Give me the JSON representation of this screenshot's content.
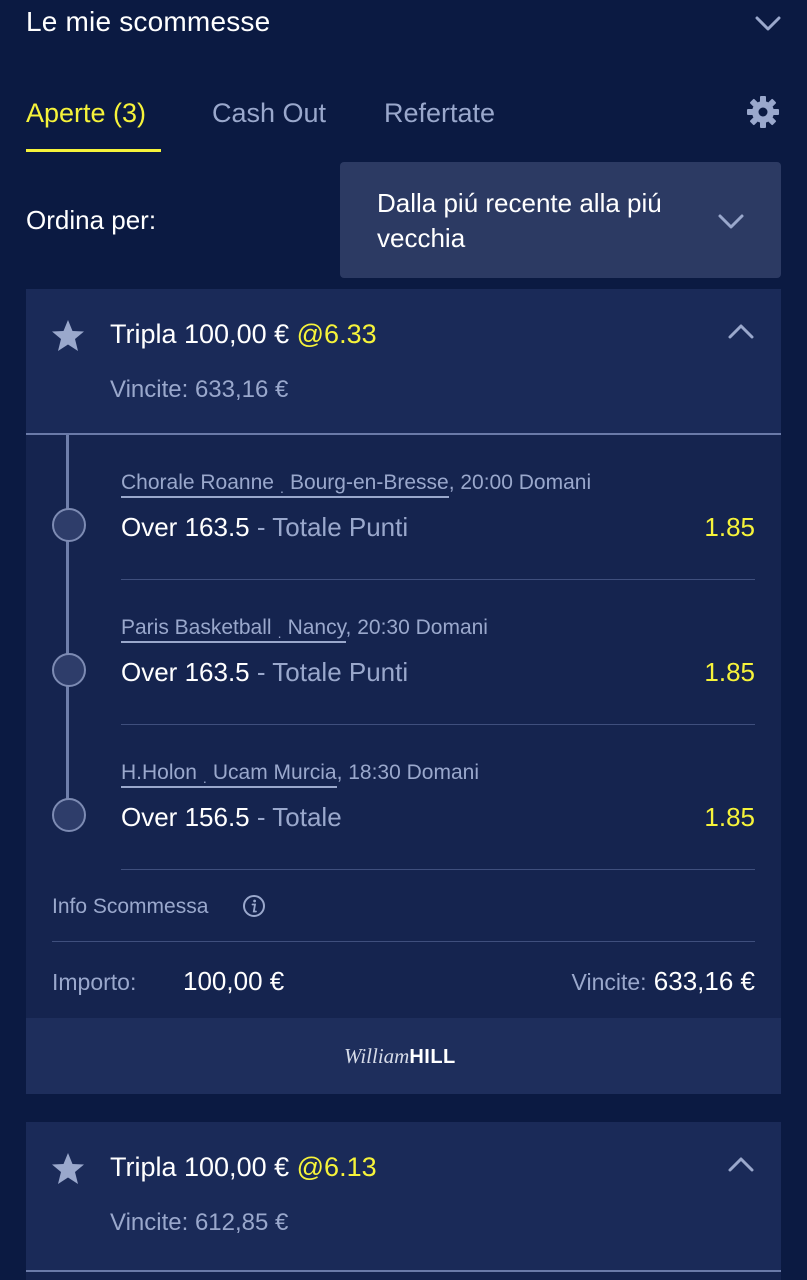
{
  "header": {
    "title": "Le mie scommesse"
  },
  "tabs": [
    {
      "label": "Aperte (3)",
      "active": true
    },
    {
      "label": "Cash Out",
      "active": false
    },
    {
      "label": "Refertate",
      "active": false
    }
  ],
  "sort": {
    "label": "Ordina per:",
    "value": "Dalla piú recente alla piú vecchia"
  },
  "bets": [
    {
      "title": "Tripla 100,00 €",
      "odds": "@6.33",
      "winnings": "Vincite: 633,16 €",
      "legs": [
        {
          "home": "Chorale Roanne",
          "away": "Bourg-en-Bresse",
          "time": ", 20:00 Domani",
          "selection": "Over 163.5",
          "market": " - Totale Punti",
          "odds": "1.85"
        },
        {
          "home": "Paris Basketball",
          "away": "Nancy",
          "time": ", 20:30 Domani",
          "selection": "Over 163.5",
          "market": " - Totale Punti",
          "odds": "1.85"
        },
        {
          "home": "H.Holon",
          "away": "Ucam Murcia",
          "time": ", 18:30 Domani",
          "selection": "Over 156.5",
          "market": " - Totale",
          "odds": "1.85"
        }
      ],
      "info_label": "Info Scommessa",
      "stake_label": "Importo:",
      "stake": "100,00 €",
      "payout_label": "Vincite:",
      "payout": "633,16 €",
      "brand": {
        "script": "William",
        "bold": "HILL"
      }
    },
    {
      "title": "Tripla 100,00 €",
      "odds": "@6.13",
      "winnings": "Vincite: 612,85 €"
    }
  ],
  "colors": {
    "background": "#0b1a42",
    "card": "#15244f",
    "accent": "#f6f33a",
    "muted": "#9aa8cc"
  },
  "icons": [
    "chevron-down-icon",
    "gear-icon",
    "star-icon",
    "chevron-up-icon",
    "info-icon"
  ]
}
